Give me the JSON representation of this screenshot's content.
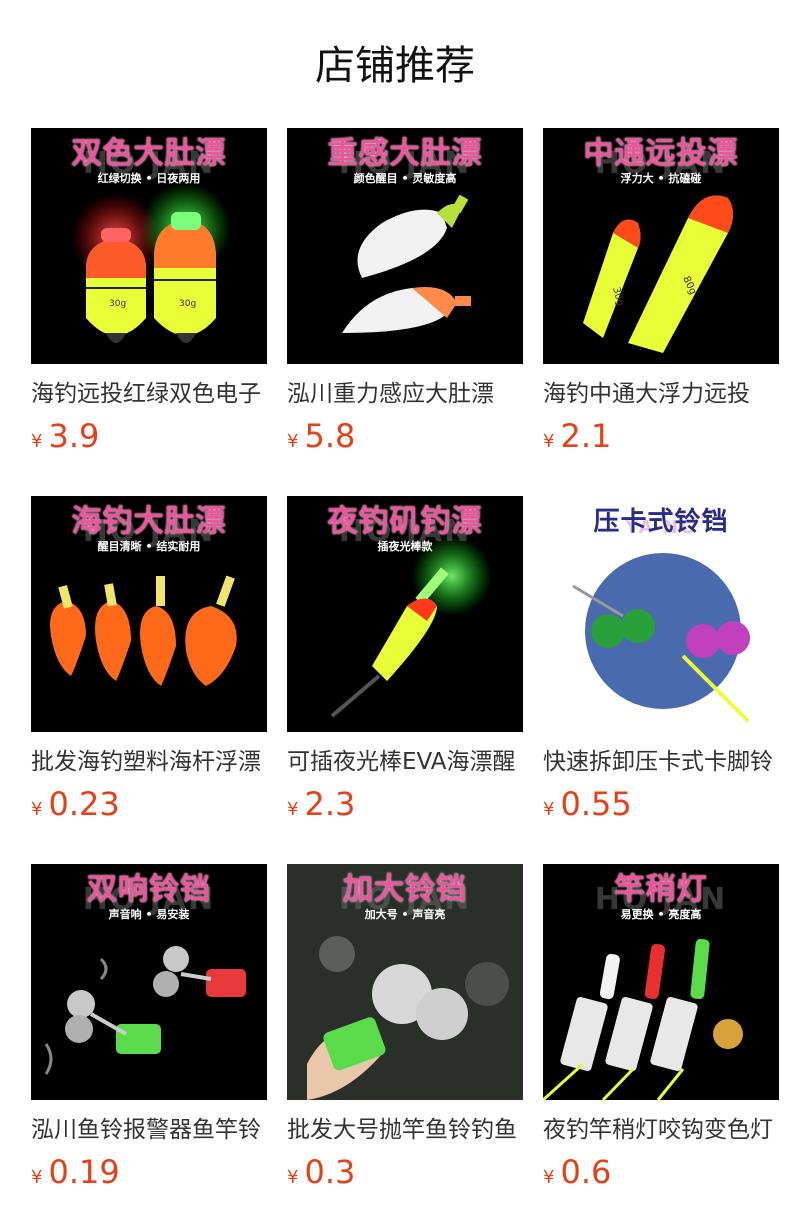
{
  "header": {
    "title": "店铺推荐"
  },
  "products": [
    {
      "banner": "双色大肚漂",
      "sub": "红绿切换 • 日夜两用",
      "watermark": "HO  JAN",
      "name": "海钓远投红绿双色电子",
      "currency": "¥",
      "price": "3.9"
    },
    {
      "banner": "重感大肚漂",
      "sub": "颜色醒目 • 灵敏度高",
      "watermark": "HO  JAN",
      "name": "泓川重力感应大肚漂",
      "currency": "¥",
      "price": "5.8"
    },
    {
      "banner": "中通远投漂",
      "sub": "浮力大 • 抗磕碰",
      "watermark": "HO  JAN",
      "name": "海钓中通大浮力远投",
      "currency": "¥",
      "price": "2.1"
    },
    {
      "banner": "海钓大肚漂",
      "sub": "醒目清晰 • 结实耐用",
      "watermark": "HO  JAN",
      "name": "批发海钓塑料海杆浮漂",
      "currency": "¥",
      "price": "0.23"
    },
    {
      "banner": "夜钓矶钓漂",
      "sub": "插夜光棒款",
      "watermark": "HO  JAN",
      "name": "可插夜光棒EVA海漂醒",
      "currency": "¥",
      "price": "2.3"
    },
    {
      "banner": "压卡式铃铛",
      "sub": "",
      "watermark": "YA          NG",
      "name": "快速拆卸压卡式卡脚铃",
      "currency": "¥",
      "price": "0.55"
    },
    {
      "banner": "双响铃铛",
      "sub": "声音响 • 易安装",
      "watermark": "HO  JAN",
      "name": "泓川鱼铃报警器鱼竿铃",
      "currency": "¥",
      "price": "0.19"
    },
    {
      "banner": "加大铃铛",
      "sub": "加大号 • 声音亮",
      "watermark": "HO  JAN",
      "name": "批发大号抛竿鱼铃钓鱼",
      "currency": "¥",
      "price": "0.3"
    },
    {
      "banner": "竿稍灯",
      "sub": "易更换 • 亮度高",
      "watermark": "HO  JAN",
      "name": "夜钓竿稍灯咬钩变色灯",
      "currency": "¥",
      "price": "0.6"
    }
  ]
}
